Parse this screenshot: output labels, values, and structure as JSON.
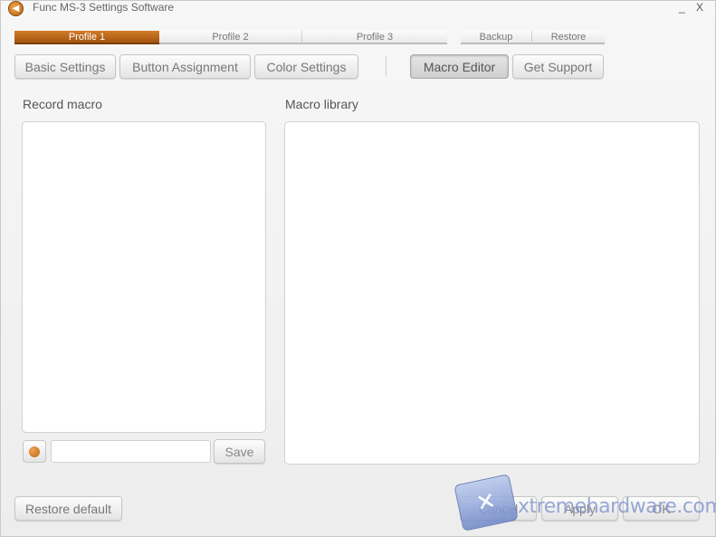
{
  "window": {
    "title": "Func MS-3 Settings Software",
    "minimize_label": "_",
    "close_label": "X",
    "accent_color": "#b8641a"
  },
  "profile_tabs": [
    {
      "label": "Profile 1",
      "active": true
    },
    {
      "label": "Profile 2",
      "active": false
    },
    {
      "label": "Profile 3",
      "active": false
    }
  ],
  "backup_restore": {
    "backup_label": "Backup",
    "restore_label": "Restore"
  },
  "nav": {
    "basic_settings": "Basic Settings",
    "button_assignment": "Button Assignment",
    "color_settings": "Color Settings",
    "macro_editor": "Macro Editor",
    "get_support": "Get Support",
    "active": "Macro Editor"
  },
  "record": {
    "title": "Record macro",
    "macro_name_value": "",
    "save_label": "Save"
  },
  "library": {
    "title": "Macro library"
  },
  "footer": {
    "restore_default_label": "Restore default",
    "cancel_label": "Cancel",
    "apply_label": "Apply",
    "ok_label": "OK"
  },
  "watermark": {
    "text": "xtremehardware.com"
  }
}
